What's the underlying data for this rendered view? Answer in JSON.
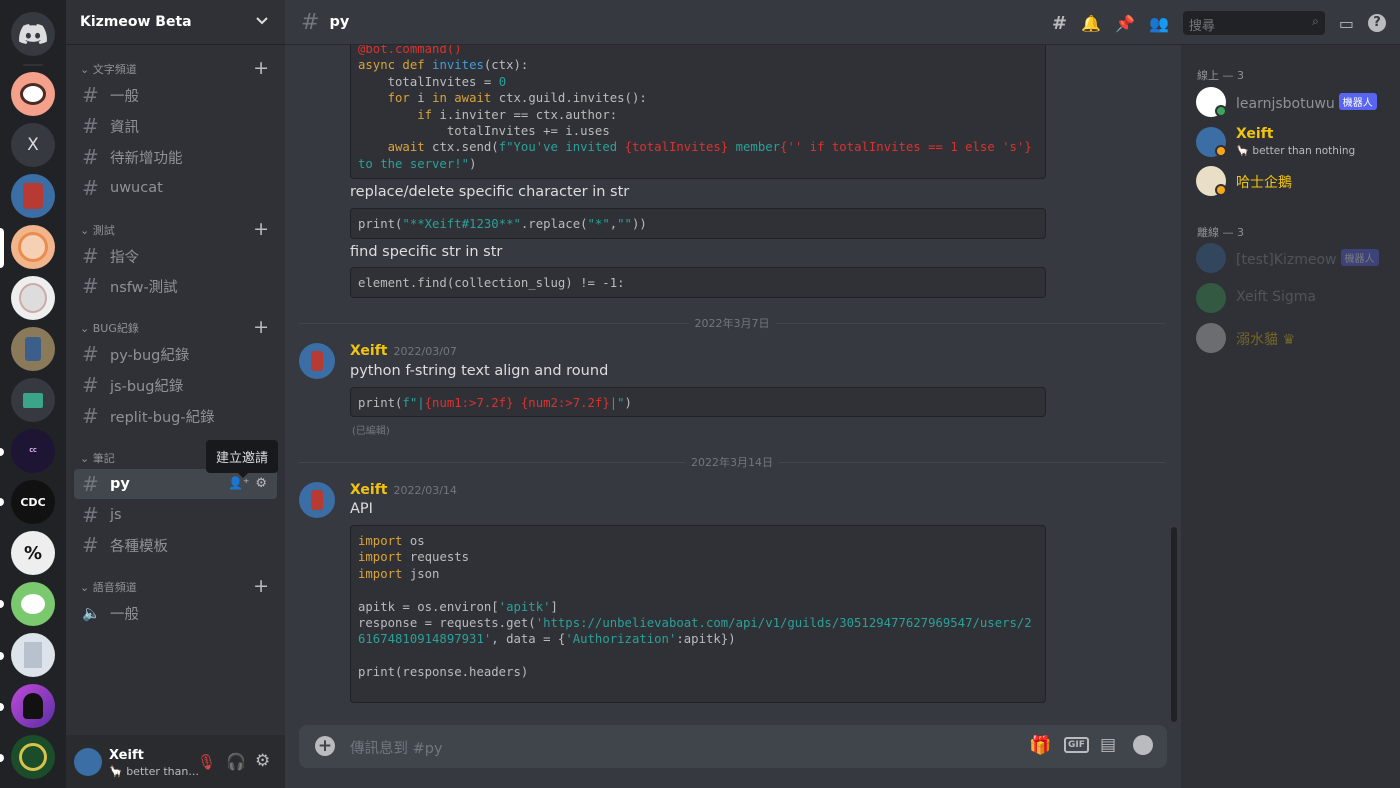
{
  "sidebar": {
    "guild_name": "Kizmeow Beta",
    "categories": [
      {
        "label": "文字頻道",
        "channels": [
          "一般",
          "資訊",
          "待新增功能",
          "uwucat"
        ]
      },
      {
        "label": "測試",
        "channels": [
          "指令",
          "nsfw-測試"
        ]
      },
      {
        "label": "BUG紀錄",
        "channels": [
          "py-bug紀錄",
          "js-bug紀錄",
          "replit-bug-紀錄"
        ]
      },
      {
        "label": "筆記",
        "channels": [
          "py",
          "js",
          "各種模板"
        ]
      },
      {
        "label": "語音頻道",
        "channels": [
          "一般"
        ]
      }
    ],
    "tooltip": "建立邀請",
    "user": {
      "name": "Xeift",
      "status": "better than..."
    }
  },
  "rail": {
    "x_label": "X"
  },
  "header": {
    "channel": "py",
    "search_placeholder": "搜尋"
  },
  "messages": {
    "code1": [
      "@bot.command()",
      "async def invites(ctx):",
      "    totalInvites = 0",
      "    for i in await ctx.guild.invites():",
      "        if i.inviter == ctx.author:",
      "            totalInvites += i.uses",
      "    await ctx.send(f\"You've invited {totalInvites} member{'' if totalInvites == 1 else 's'} to the server!\")"
    ],
    "text1": "replace/delete specific character in str",
    "code2": "print(\"**Xeift#1230**\".replace(\"*\",\"\"))",
    "text2": "find specific str in str",
    "code3": "element.find(collection_slug) != -1:",
    "divider1": "2022年3月7日",
    "msg1_author": "Xeift",
    "msg1_time": "2022/03/07",
    "msg1_text": "python f-string text align and round",
    "code4": "print(f\"|{num1:>7.2f} {num2:>7.2f}|\")",
    "edited": "(已編輯)",
    "divider2": "2022年3月14日",
    "msg2_author": "Xeift",
    "msg2_time": "2022/03/14",
    "msg2_text": "API",
    "code5": "import os\nimport requests\nimport json\n\napitk = os.environ['apitk']\nresponse = requests.get('https://unbelievaboat.com/api/v1/guilds/305129477627969547/users/261674810914897931', data = {'Authorization':apitk})\n\nprint(response.headers)",
    "composer_placeholder": "傳訊息到 #py"
  },
  "members": {
    "online_label": "線上 — 3",
    "offline_label": "離線 — 3",
    "online": [
      {
        "name": "learnjsbotuwu",
        "badge": "機器人",
        "status_color": "#3ba55d"
      },
      {
        "name": "Xeift",
        "sub": "better than nothing",
        "status_color": "#faa61a"
      },
      {
        "name": "哈士企鵝",
        "status_color": "#faa61a"
      }
    ],
    "offline": [
      {
        "name": "[test]Kizmeow",
        "badge": "機器人"
      },
      {
        "name": "Xeift Sigma"
      },
      {
        "name": "溺水貓"
      }
    ]
  },
  "colors": {
    "accent": "#5865f2",
    "gold": "#f1c40f",
    "online": "#3ba55d",
    "idle": "#faa61a"
  }
}
